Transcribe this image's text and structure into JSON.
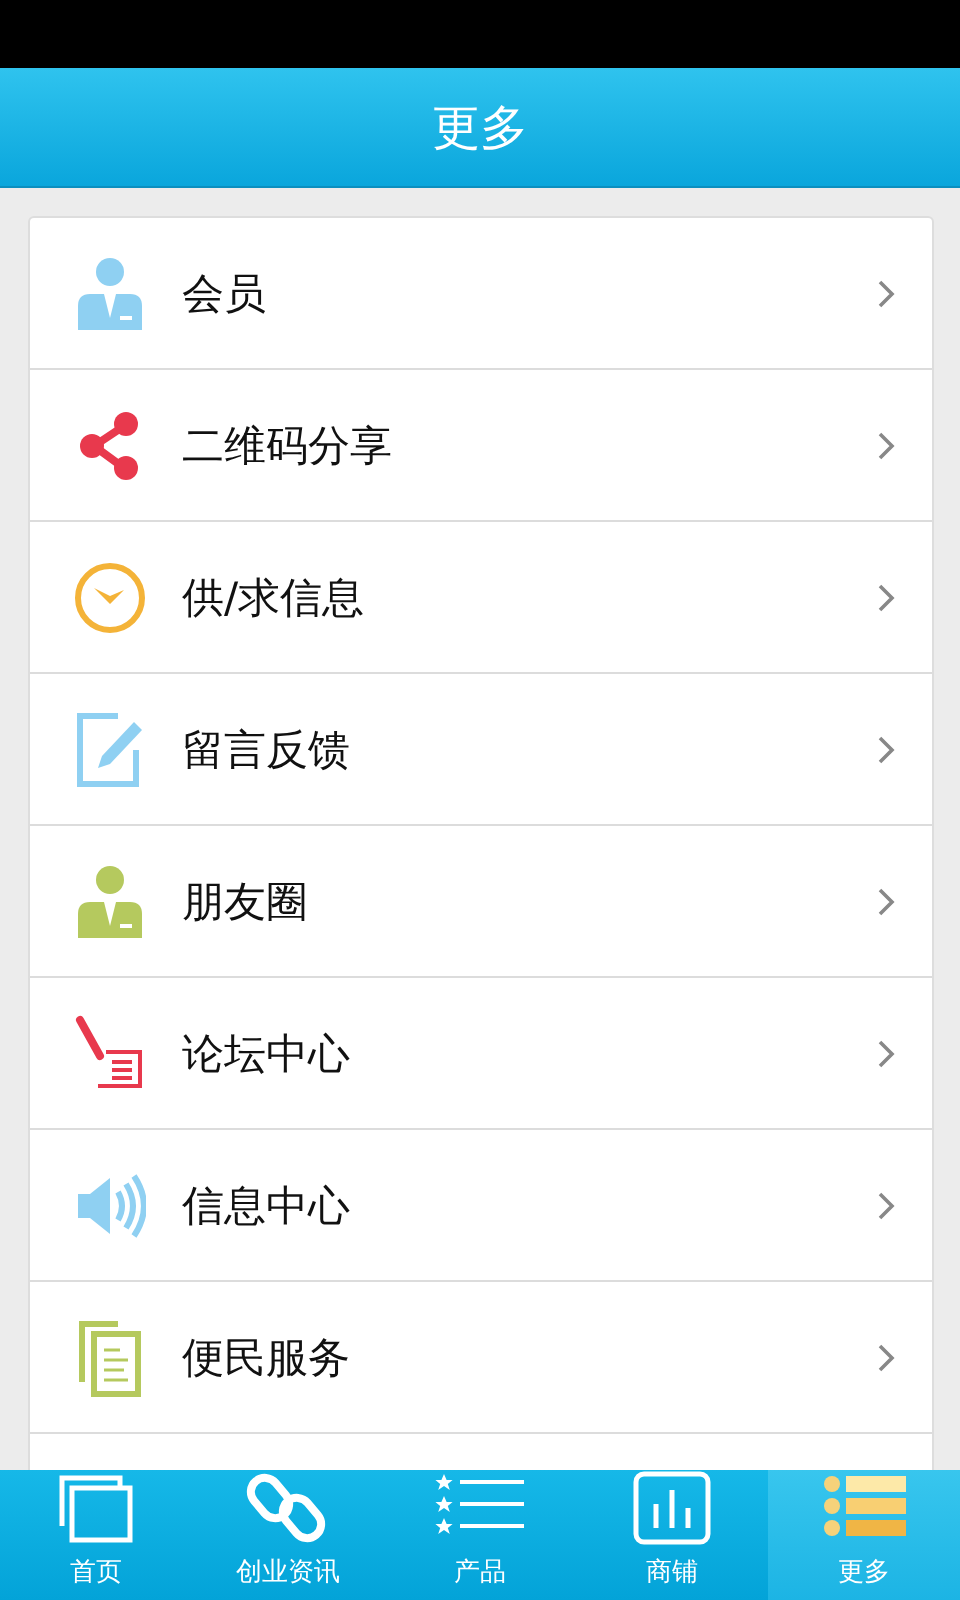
{
  "header": {
    "title": "更多"
  },
  "items": [
    {
      "label": "会员",
      "kind": "member"
    },
    {
      "label": "二维码分享",
      "kind": "share"
    },
    {
      "label": "供/求信息",
      "kind": "clock"
    },
    {
      "label": "留言反馈",
      "kind": "edit"
    },
    {
      "label": "朋友圈",
      "kind": "friend"
    },
    {
      "label": "论坛中心",
      "kind": "forum"
    },
    {
      "label": "信息中心",
      "kind": "speaker"
    },
    {
      "label": "便民服务",
      "kind": "docs"
    }
  ],
  "tabs": [
    {
      "label": "首页",
      "kind": "home",
      "selected": false
    },
    {
      "label": "创业资讯",
      "kind": "link",
      "selected": false
    },
    {
      "label": "产品",
      "kind": "list",
      "selected": false
    },
    {
      "label": "商铺",
      "kind": "chart",
      "selected": false
    },
    {
      "label": "更多",
      "kind": "more",
      "selected": true
    }
  ]
}
